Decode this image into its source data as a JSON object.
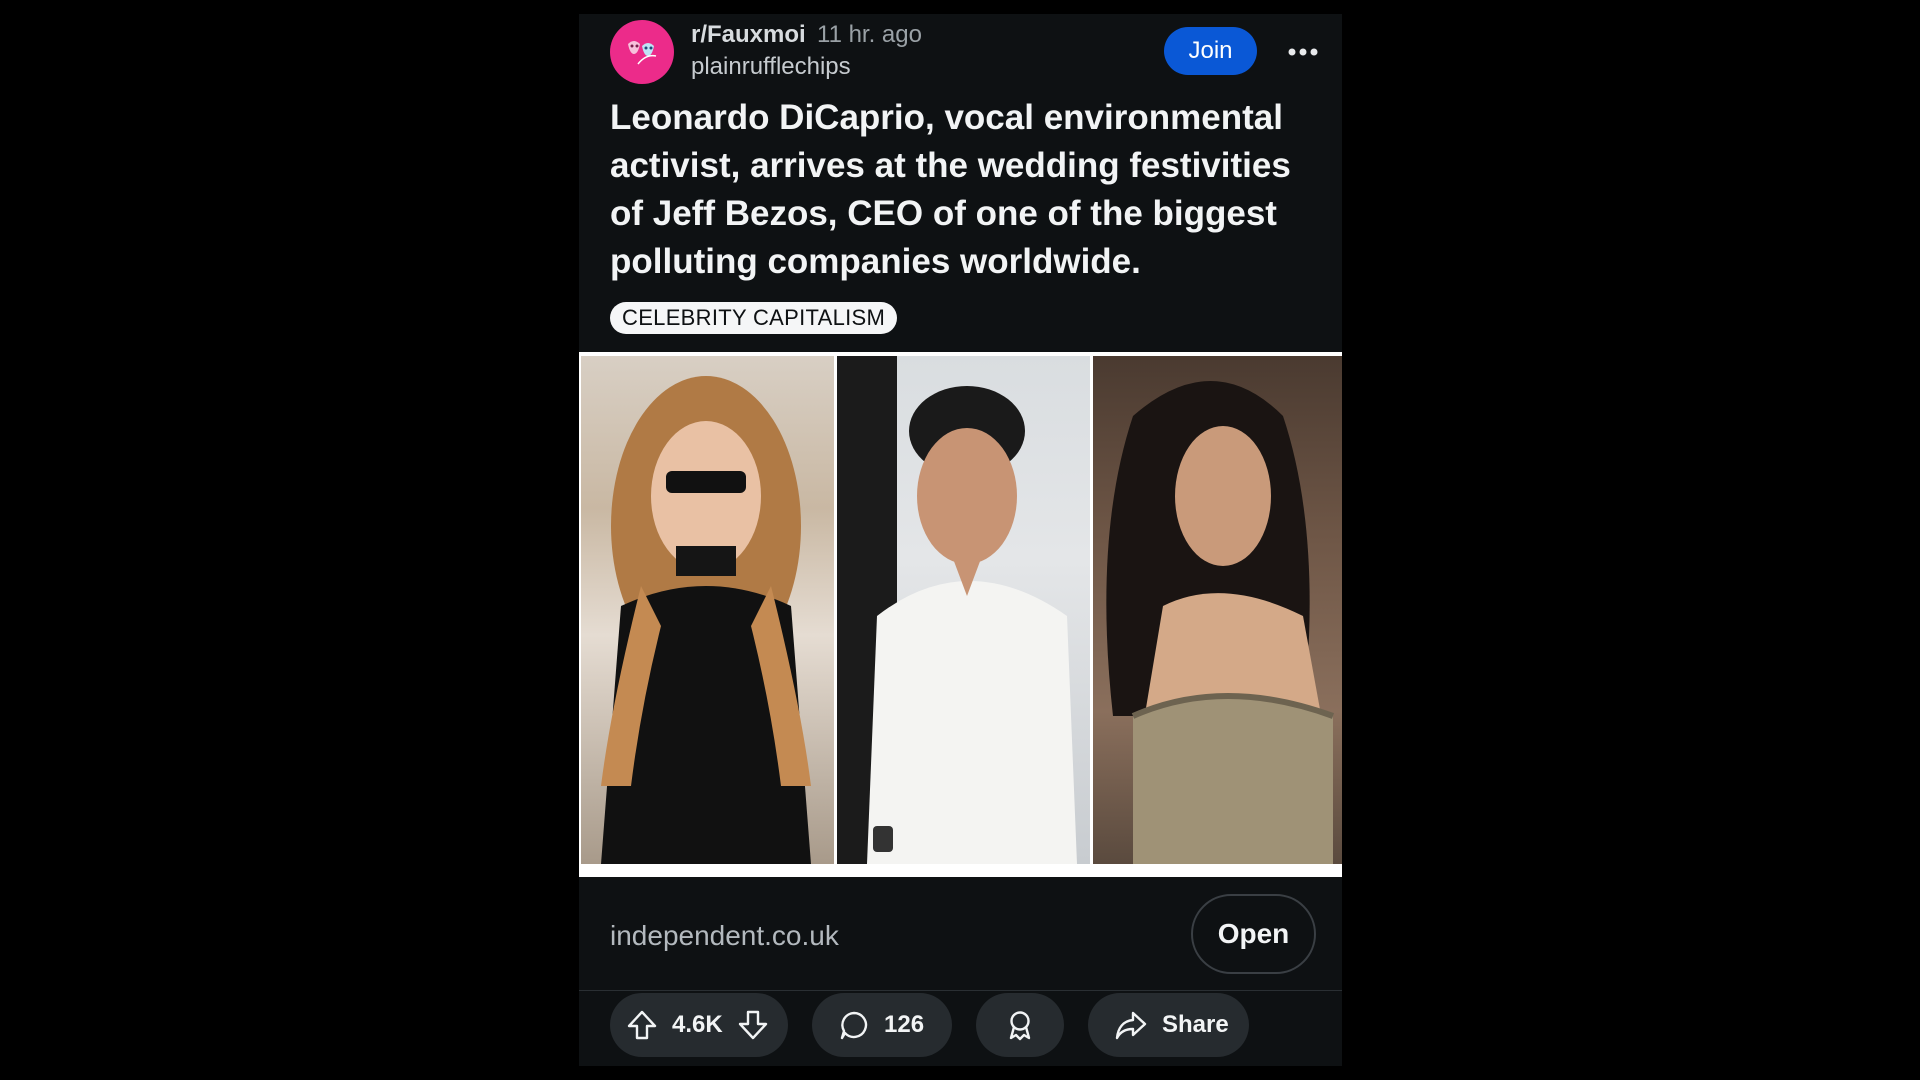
{
  "post": {
    "subreddit": "r/Fauxmoi",
    "time_ago": "11 hr. ago",
    "author": "plainrufflechips",
    "join_label": "Join",
    "title": "Leonardo DiCaprio, vocal environmental activist, arrives at the wedding festivities of Jeff Bezos, CEO of one of the biggest polluting companies worldwide.",
    "flair": "CELEBRITY CAPITALISM"
  },
  "link": {
    "domain": "independent.co.uk",
    "open_label": "Open"
  },
  "actions": {
    "votes": "4.6K",
    "comments": "126",
    "share_label": "Share"
  },
  "colors": {
    "background": "#000000",
    "card": "#0e1113",
    "join_button": "#0a58d6",
    "avatar": "#ec2b8a",
    "pill": "#262b2f"
  },
  "icons": [
    "subreddit-avatar-icon",
    "more-options-icon",
    "upvote-icon",
    "downvote-icon",
    "comment-icon",
    "award-icon",
    "share-icon"
  ]
}
